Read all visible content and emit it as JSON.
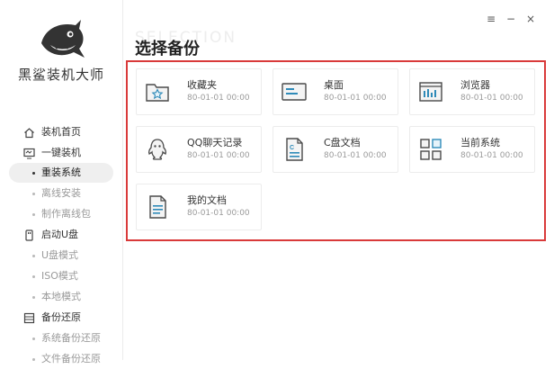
{
  "app": {
    "brand": "黑鲨装机大师"
  },
  "window_controls": {
    "menu": "≡",
    "minimize": "−",
    "close": "×"
  },
  "main": {
    "title": "选择备份",
    "title_watermark": "SELECTION",
    "accent_color": "#d93a3a"
  },
  "sidebar": {
    "items": [
      {
        "label": "装机首页",
        "icon": "home-icon",
        "type": "section"
      },
      {
        "label": "一键装机",
        "icon": "monitor-icon",
        "type": "section"
      },
      {
        "label": "重装系统",
        "type": "sub",
        "active": true
      },
      {
        "label": "离线安装",
        "type": "sub"
      },
      {
        "label": "制作离线包",
        "type": "sub"
      },
      {
        "label": "启动U盘",
        "icon": "usb-icon",
        "type": "section"
      },
      {
        "label": "U盘模式",
        "type": "sub"
      },
      {
        "label": "ISO模式",
        "type": "sub"
      },
      {
        "label": "本地模式",
        "type": "sub"
      },
      {
        "label": "备份还原",
        "icon": "backup-icon",
        "type": "section"
      },
      {
        "label": "系统备份还原",
        "type": "sub"
      },
      {
        "label": "文件备份还原",
        "type": "sub"
      }
    ]
  },
  "backup_items": [
    {
      "name": "收藏夹",
      "time": "80-01-01 00:00",
      "icon": "favorites-folder-icon"
    },
    {
      "name": "桌面",
      "time": "80-01-01 00:00",
      "icon": "desktop-icon"
    },
    {
      "name": "浏览器",
      "time": "80-01-01 00:00",
      "icon": "browser-icon"
    },
    {
      "name": "QQ聊天记录",
      "time": "80-01-01 00:00",
      "icon": "qq-icon"
    },
    {
      "name": "C盘文档",
      "time": "80-01-01 00:00",
      "icon": "c-drive-document-icon"
    },
    {
      "name": "当前系统",
      "time": "80-01-01 00:00",
      "icon": "system-icon"
    },
    {
      "name": "我的文档",
      "time": "80-01-01 00:00",
      "icon": "my-document-icon"
    }
  ]
}
